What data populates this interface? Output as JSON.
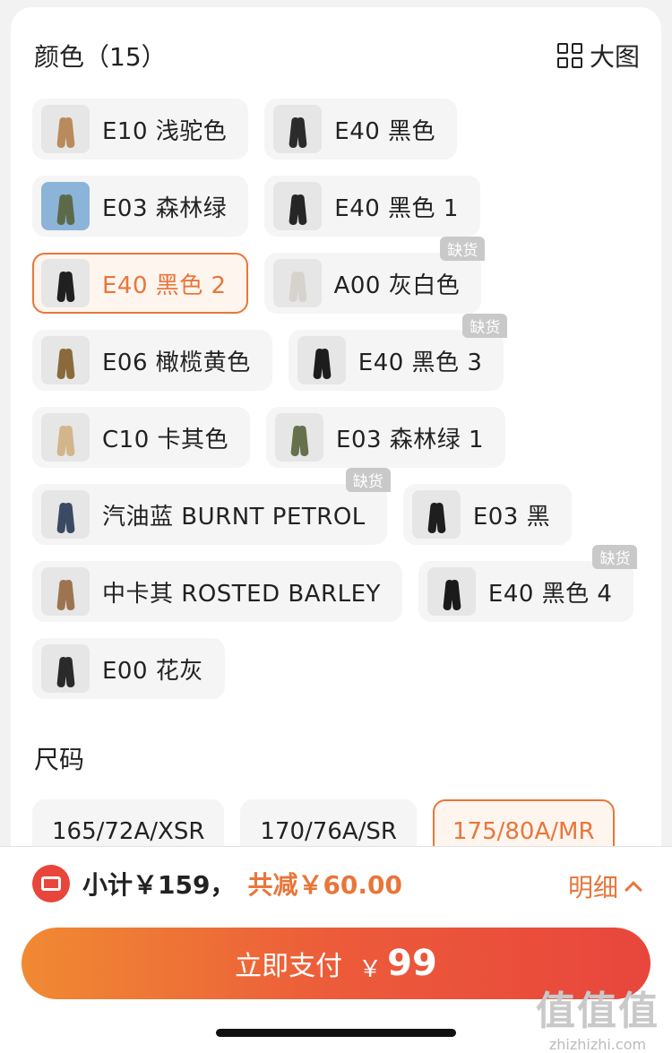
{
  "color_section": {
    "title": "颜色（15）",
    "view_toggle": "大图",
    "out_of_stock_label": "缺货",
    "options": [
      {
        "label": "E10 浅驼色",
        "pant_color": "#b88a5c"
      },
      {
        "label": "E40 黑色",
        "pant_color": "#2b2b2b"
      },
      {
        "label": "E03 森林绿",
        "pant_color": "#5b6b4a"
      },
      {
        "label": "E40 黑色 1",
        "pant_color": "#262626"
      },
      {
        "label": "E40 黑色 2",
        "pant_color": "#202020",
        "selected": true
      },
      {
        "label": "A00 灰白色",
        "pant_color": "#d6d3cc",
        "out_of_stock": true
      },
      {
        "label": "E06 橄榄黄色",
        "pant_color": "#8a6a3a"
      },
      {
        "label": "E40 黑色 3",
        "pant_color": "#1d1d1d",
        "out_of_stock": true
      },
      {
        "label": "C10 卡其色",
        "pant_color": "#d2b58a"
      },
      {
        "label": "E03 森林绿 1",
        "pant_color": "#66704c"
      },
      {
        "label": "汽油蓝 BURNT PETROL",
        "pant_color": "#3b4a63",
        "out_of_stock": true
      },
      {
        "label": "E03 黑",
        "pant_color": "#1e1e1e"
      },
      {
        "label": "中卡其 ROSTED BARLEY",
        "pant_color": "#9c7550"
      },
      {
        "label": "E40 黑色 4",
        "pant_color": "#1a1a1a",
        "out_of_stock": true
      },
      {
        "label": "E00 花灰",
        "pant_color": "#2a2a2a"
      }
    ]
  },
  "size_section": {
    "title": "尺码",
    "options": [
      {
        "label": "165/72A/XSR"
      },
      {
        "label": "170/76A/SR"
      },
      {
        "label": "175/80A/MR",
        "selected": true
      }
    ]
  },
  "summary": {
    "subtotal": "小计￥159，",
    "discount": "共减￥60.00",
    "detail_label": "明细"
  },
  "pay_button": {
    "label": "立即支付",
    "currency": "￥",
    "amount": "99"
  },
  "watermark": {
    "big": "值值值",
    "small": "zhizhizhi.com"
  },
  "colors": {
    "accent": "#e8763a",
    "pay_gradient_start": "#f08a33",
    "pay_gradient_end": "#e8463c"
  }
}
